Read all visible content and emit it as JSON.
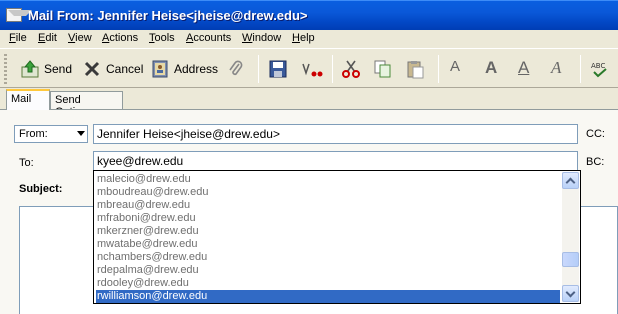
{
  "window": {
    "title": "Mail From: Jennifer Heise<jheise@drew.edu>"
  },
  "menu": [
    "File",
    "Edit",
    "View",
    "Actions",
    "Tools",
    "Accounts",
    "Window",
    "Help"
  ],
  "toolbar": {
    "send": "Send",
    "cancel": "Cancel",
    "address": "Address",
    "format_buttons": [
      "A",
      "A",
      "A",
      "A"
    ]
  },
  "tabs": {
    "mail": "Mail",
    "send_options": "Send Options"
  },
  "form": {
    "from_select": "From:",
    "from_value": "Jennifer Heise<jheise@drew.edu>",
    "cc_label": "CC:",
    "to_label": "To:",
    "to_value": "kyee@drew.edu",
    "bc_label": "BC:",
    "subject_label": "Subject:"
  },
  "autocomplete": {
    "items": [
      "malecio@drew.edu",
      "mboudreau@drew.edu",
      "mbreau@drew.edu",
      "mfraboni@drew.edu",
      "mkerzner@drew.edu",
      "mwatabe@drew.edu",
      "nchambers@drew.edu",
      "rdepalma@drew.edu",
      "rdooley@drew.edu",
      "rwilliamson@drew.edu"
    ],
    "selected_index": 9
  }
}
